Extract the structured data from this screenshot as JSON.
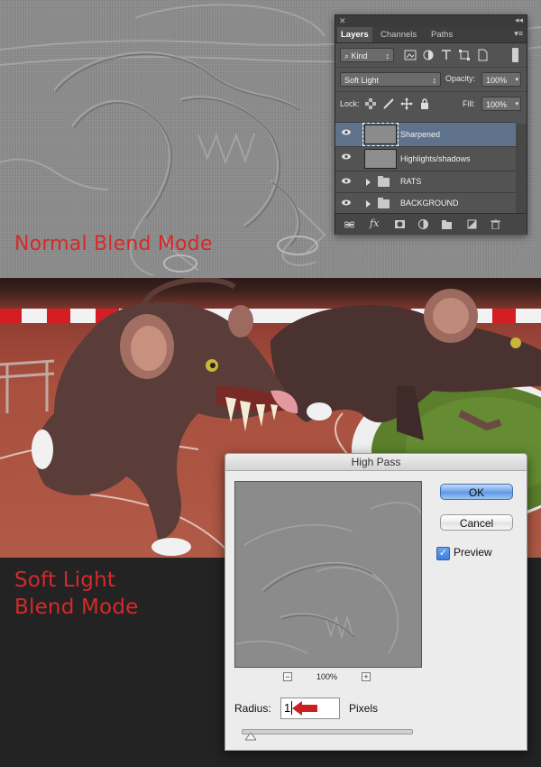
{
  "captions": {
    "top": "Normal Blend Mode",
    "bottom_line1": "Soft Light",
    "bottom_line2": "Blend Mode"
  },
  "layers_panel": {
    "tabs": [
      {
        "label": "Layers",
        "active": true
      },
      {
        "label": "Channels",
        "active": false
      },
      {
        "label": "Paths",
        "active": false
      }
    ],
    "filter_kind": "Kind",
    "blend_mode": "Soft Light",
    "opacity_label": "Opacity:",
    "opacity_value": "100%",
    "lock_label": "Lock:",
    "fill_label": "Fill:",
    "fill_value": "100%",
    "layers": [
      {
        "name": "Sharpened",
        "type": "layer",
        "selected": true,
        "visible": true
      },
      {
        "name": "Highlights/shadows",
        "type": "layer",
        "selected": false,
        "visible": true
      },
      {
        "name": "RATS",
        "type": "group",
        "selected": false,
        "visible": true
      },
      {
        "name": "BACKGROUND",
        "type": "group",
        "selected": false,
        "visible": true
      }
    ],
    "fx_label": "fx"
  },
  "high_pass": {
    "title": "High Pass",
    "ok_label": "OK",
    "cancel_label": "Cancel",
    "preview_label": "Preview",
    "preview_checked": true,
    "zoom": "100%",
    "radius_label": "Radius:",
    "radius_value": "1",
    "unit_label": "Pixels",
    "arrow_color": "#cc1f1f"
  },
  "colors": {
    "caption_red": "#d42a2a",
    "panel_bg": "#535353",
    "selected_layer": "#5f728c"
  }
}
